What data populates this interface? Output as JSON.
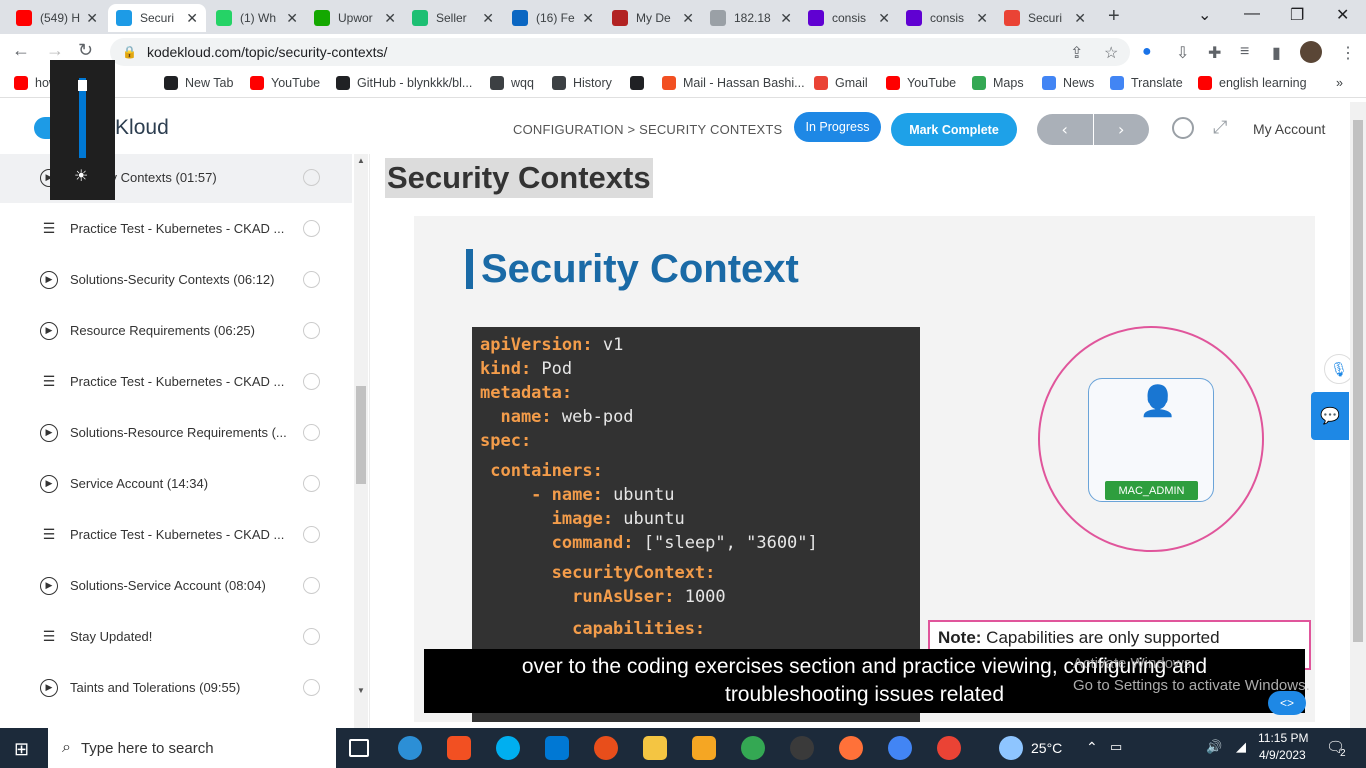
{
  "browser": {
    "tabs": [
      {
        "title": "(549) H",
        "fav_color": "#ff0000",
        "active": false
      },
      {
        "title": "Securi",
        "fav_color": "#1d9be6",
        "active": true
      },
      {
        "title": "(1) Wh",
        "fav_color": "#25d366",
        "active": false
      },
      {
        "title": "Upwor",
        "fav_color": "#14a800",
        "active": false
      },
      {
        "title": "Seller",
        "fav_color": "#1dbf73",
        "active": false
      },
      {
        "title": "(16) Fe",
        "fav_color": "#0a66c2",
        "active": false
      },
      {
        "title": "My De",
        "fav_color": "#b22222",
        "active": false
      },
      {
        "title": "182.18",
        "fav_color": "#9aa0a6",
        "active": false
      },
      {
        "title": "consis",
        "fav_color": "#6001d2",
        "active": false
      },
      {
        "title": "consis",
        "fav_color": "#6001d2",
        "active": false
      },
      {
        "title": "Securi",
        "fav_color": "#ea4335",
        "active": false
      }
    ],
    "url": "kodekloud.com/topic/security-contexts/",
    "bookmarks": [
      {
        "label": "how...rdu i...",
        "color": "#ff0000"
      },
      {
        "label": "New Tab",
        "color": "#202124"
      },
      {
        "label": "YouTube",
        "color": "#ff0000"
      },
      {
        "label": "GitHub - blynkkk/bl...",
        "color": "#202124"
      },
      {
        "label": "wqq",
        "color": "#3c4043"
      },
      {
        "label": "History",
        "color": "#3c4043"
      },
      {
        "label": "",
        "color": "#202124"
      },
      {
        "label": "Mail - Hassan Bashi...",
        "color": "#f25022"
      },
      {
        "label": "Gmail",
        "color": "#ea4335"
      },
      {
        "label": "YouTube",
        "color": "#ff0000"
      },
      {
        "label": "Maps",
        "color": "#34a853"
      },
      {
        "label": "News",
        "color": "#4285f4"
      },
      {
        "label": "Translate",
        "color": "#4285f4"
      },
      {
        "label": "english learning",
        "color": "#ff0000"
      }
    ]
  },
  "site": {
    "logo": "KodeKloud",
    "breadcrumb": "CONFIGURATION > SECURITY CONTEXTS",
    "in_progress": "In Progress",
    "mark_complete": "Mark Complete",
    "prev": "‹",
    "next": "›",
    "account": "My Account"
  },
  "sidebar": {
    "lessons": [
      {
        "name": "Security Contexts (01:57)",
        "type": "video",
        "current": true
      },
      {
        "name": "Practice Test - Kubernetes - CKAD ...",
        "type": "doc"
      },
      {
        "name": "Solutions-Security Contexts (06:12)",
        "type": "video"
      },
      {
        "name": "Resource Requirements (06:25)",
        "type": "video"
      },
      {
        "name": "Practice Test - Kubernetes - CKAD ...",
        "type": "doc"
      },
      {
        "name": "Solutions-Resource Requirements (...",
        "type": "video"
      },
      {
        "name": "Service Account (14:34)",
        "type": "video"
      },
      {
        "name": "Practice Test - Kubernetes - CKAD ...",
        "type": "doc"
      },
      {
        "name": "Solutions-Service Account (08:04)",
        "type": "video"
      },
      {
        "name": "Stay Updated!",
        "type": "doc"
      },
      {
        "name": "Taints and Tolerations (09:55)",
        "type": "video"
      }
    ]
  },
  "main": {
    "title": "Security Contexts",
    "slide": {
      "heading": "Security Context",
      "code": [
        {
          "k": "apiVersion:",
          "v": " v1",
          "indent": 0
        },
        {
          "k": "kind:",
          "v": " Pod",
          "indent": 0
        },
        {
          "k": "metadata:",
          "v": "",
          "indent": 0
        },
        {
          "k": "  name:",
          "v": " web-pod",
          "indent": 0
        },
        {
          "k": "spec:",
          "v": "",
          "indent": 0
        },
        {
          "k": " containers:",
          "v": "",
          "indent": 0
        },
        {
          "k": "     - name:",
          "v": " ubuntu",
          "indent": 0
        },
        {
          "k": "       image:",
          "v": " ubuntu",
          "indent": 0
        },
        {
          "k": "       command:",
          "v": " [\"sleep\", \"3600\"]",
          "indent": 0
        },
        {
          "k": "       securityContext:",
          "v": "",
          "indent": 0
        },
        {
          "k": "         runAsUser:",
          "v": " 1000",
          "indent": 0
        },
        {
          "k": "         capabilities:",
          "v": "",
          "indent": 0
        }
      ],
      "badge": "MAC_ADMIN",
      "note_label": "Note:",
      "note_text": " Capabilities are only supported"
    },
    "subtitle_line1": "over to the coding exercises section and practice viewing, configuring and",
    "subtitle_line2": "troubleshooting issues related",
    "watermark1": "Activate Windows",
    "watermark2": "Go to Settings to activate Windows.",
    "code_badge": "<>"
  },
  "taskbar": {
    "search_placeholder": "Type here to search",
    "weather": "25°C",
    "time": "11:15 PM",
    "date": "4/9/2023",
    "notifications": "2"
  }
}
